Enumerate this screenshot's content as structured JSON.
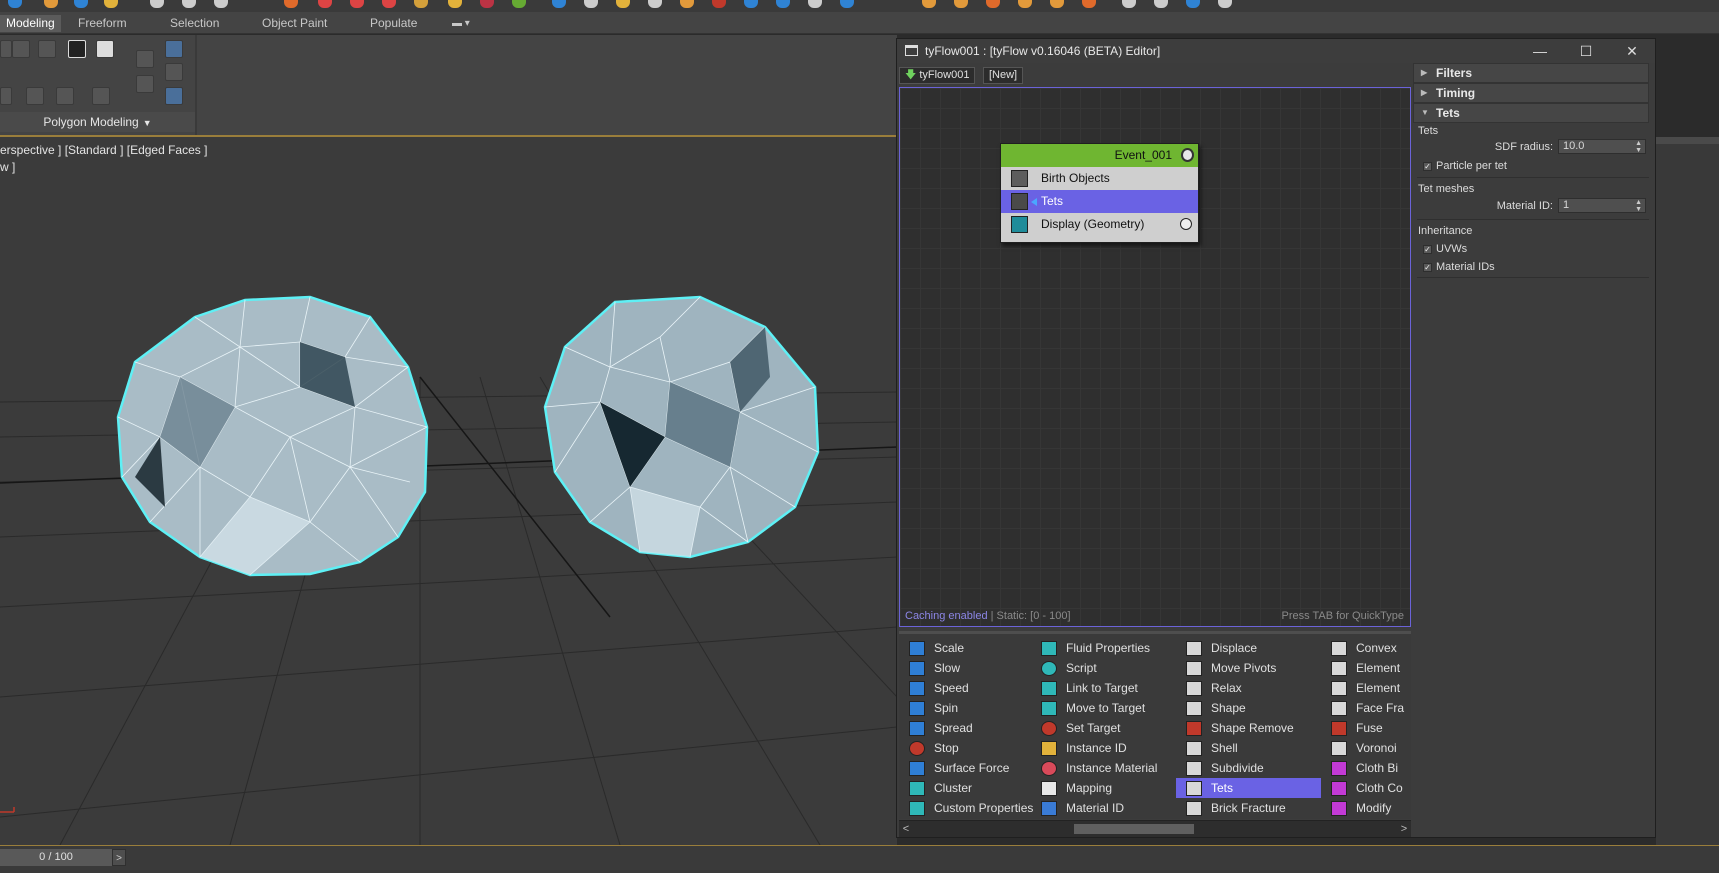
{
  "ribbon": {
    "tabs": [
      "Modeling",
      "Freeform",
      "Selection",
      "Object Paint",
      "Populate"
    ],
    "active_tab": "Modeling",
    "panel_label": "Polygon Modeling"
  },
  "viewport": {
    "label": "erspective ] [Standard ] [Edged Faces ]",
    "label2": "w ]"
  },
  "timeline": {
    "frame": "0 / 100",
    "next": ">"
  },
  "editor": {
    "title": "tyFlow001 : [tyFlow v0.16046 (BETA) Editor]",
    "window_buttons": {
      "minimize": "—",
      "maximize": "☐",
      "close": "✕"
    },
    "tabs": [
      "tyFlow001",
      "[New]"
    ],
    "status_caching": "Caching enabled",
    "status_static": " | Static: [0 - 100]",
    "status_hint": "Press TAB for QuickType",
    "event": {
      "name": "Event_001",
      "operators": [
        "Birth Objects",
        "Tets",
        "Display (Geometry)"
      ],
      "selected": "Tets"
    },
    "rollups": {
      "filters": "Filters",
      "timing": "Timing",
      "tets": "Tets"
    },
    "tets_panel": {
      "group_tets": "Tets",
      "sdf_radius_label": "SDF radius:",
      "sdf_radius_value": "10.0",
      "particle_per_tet": "Particle per tet",
      "group_tet_meshes": "Tet meshes",
      "material_id_label": "Material ID:",
      "material_id_value": "1",
      "group_inheritance": "Inheritance",
      "uvws": "UVWs",
      "material_ids": "Material IDs"
    },
    "operator_list": {
      "columns": [
        [
          "Scale",
          "Slow",
          "Speed",
          "Spin",
          "Spread",
          "Stop",
          "Surface Force",
          "Cluster",
          "Custom Properties"
        ],
        [
          "Fluid Properties",
          "Script",
          "Link to Target",
          "Move to Target",
          "Set Target",
          "Instance ID",
          "Instance Material",
          "Mapping",
          "Material ID"
        ],
        [
          "Displace",
          "Move Pivots",
          "Relax",
          "Shape",
          "Shape Remove",
          "Shell",
          "Subdivide",
          "Tets",
          "Brick Fracture"
        ],
        [
          "Convex",
          "Element",
          "Element",
          "Face Fra",
          "Fuse",
          "Voronoi",
          "Cloth Bi",
          "Cloth Co",
          "Modify"
        ]
      ],
      "selected": "Tets",
      "icon_colors": [
        "#2f7fd6",
        "#2fb8b8",
        "#e8e8e8",
        "#c0392b"
      ]
    },
    "colors": {
      "event_header": "#6fb631",
      "selection": "#6a62e4",
      "canvas_border": "#6b63d8"
    }
  }
}
